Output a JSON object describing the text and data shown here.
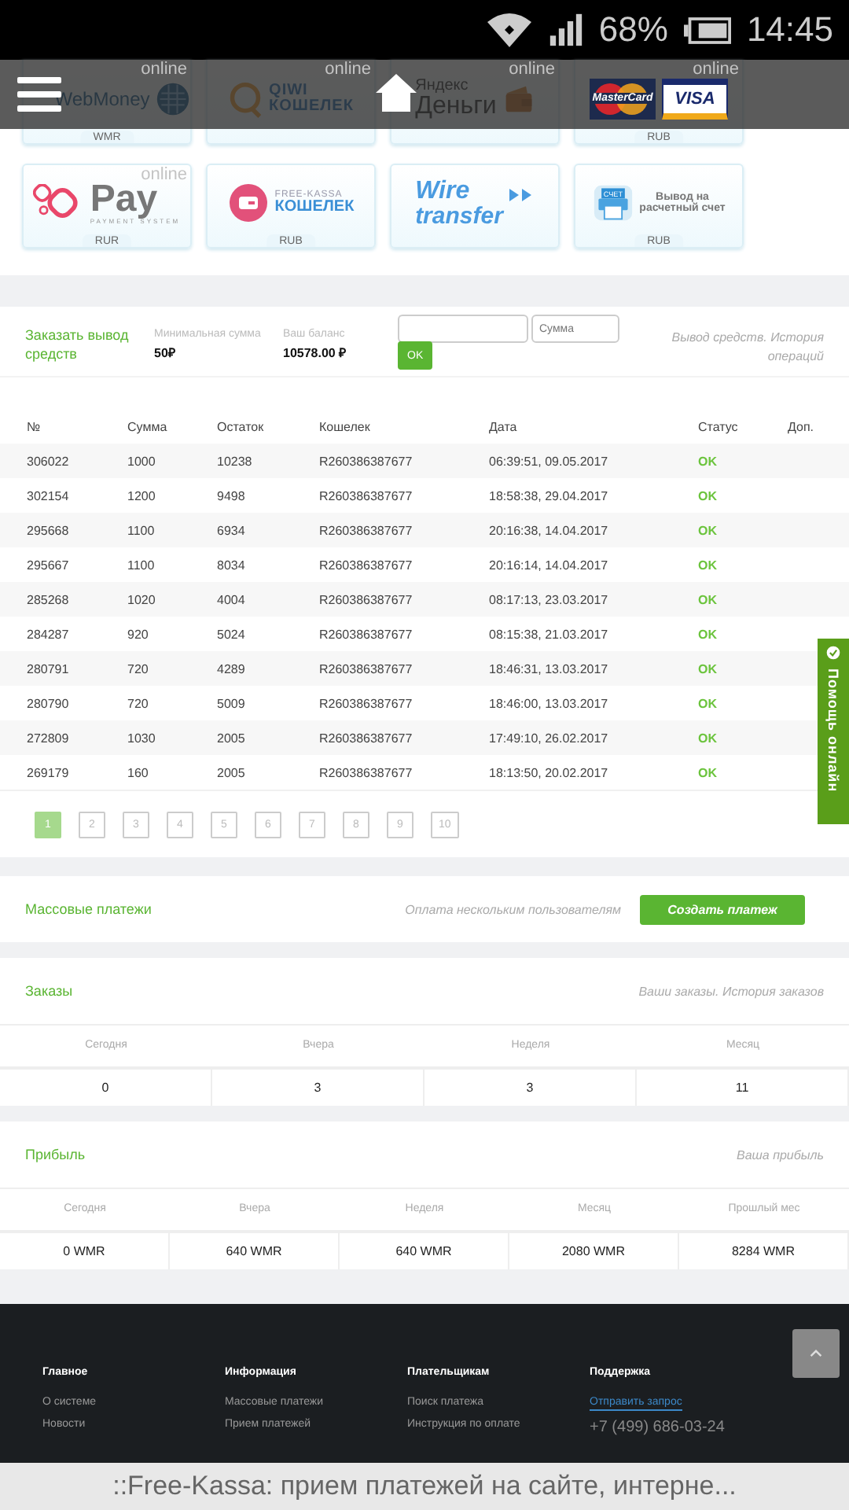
{
  "status_bar": {
    "battery": "68%",
    "time": "14:45"
  },
  "tiles": [
    {
      "kind": "webmoney",
      "badge": "online",
      "logo_lines": [
        "WebMoney"
      ],
      "currency": "WMR"
    },
    {
      "kind": "qiwi",
      "badge": "online",
      "logo_lines": [
        "QIWI",
        "КОШЕЛЕК"
      ]
    },
    {
      "kind": "yandex",
      "badge": "online",
      "logo_lines": [
        "Яндекс",
        "Деньги"
      ]
    },
    {
      "kind": "cards",
      "badge": "online",
      "logo_lines": [
        "MasterCard",
        "VISA"
      ],
      "currency": "RUB"
    },
    {
      "kind": "opay",
      "badge": "online",
      "logo_lines": [
        "Pay",
        "PAYMENT SYSTEM"
      ],
      "currency": "RUR"
    },
    {
      "kind": "freekassa",
      "logo_lines": [
        "FREE-KASSA",
        "КОШЕЛЕК"
      ],
      "currency": "RUB"
    },
    {
      "kind": "wire",
      "logo_lines": [
        "Wire",
        "transfer"
      ]
    },
    {
      "kind": "invoice",
      "icon_label": "СЧЕТ",
      "logo_lines": [
        "Вывод на",
        "расчетный счет"
      ],
      "currency": "RUB"
    }
  ],
  "withdraw": {
    "title": "Заказать вывод средств",
    "min_label": "Минимальная сумма",
    "min_value": "50₽",
    "balance_label": "Ваш баланс",
    "balance_value": "10578.00 ₽",
    "amount_placeholder": "Сумма",
    "ok_button": "OK",
    "note": "Вывод средств. История операций"
  },
  "table": {
    "columns": [
      "№",
      "Сумма",
      "Остаток",
      "Кошелек",
      "Дата",
      "Статус",
      "Доп."
    ],
    "rows": [
      [
        "306022",
        "1000",
        "10238",
        "R260386387677",
        "06:39:51, 09.05.2017",
        "OK"
      ],
      [
        "302154",
        "1200",
        "9498",
        "R260386387677",
        "18:58:38, 29.04.2017",
        "OK"
      ],
      [
        "295668",
        "1100",
        "6934",
        "R260386387677",
        "20:16:38, 14.04.2017",
        "OK"
      ],
      [
        "295667",
        "1100",
        "8034",
        "R260386387677",
        "20:16:14, 14.04.2017",
        "OK"
      ],
      [
        "285268",
        "1020",
        "4004",
        "R260386387677",
        "08:17:13, 23.03.2017",
        "OK"
      ],
      [
        "284287",
        "920",
        "5024",
        "R260386387677",
        "08:15:38, 21.03.2017",
        "OK"
      ],
      [
        "280791",
        "720",
        "4289",
        "R260386387677",
        "18:46:31, 13.03.2017",
        "OK"
      ],
      [
        "280790",
        "720",
        "5009",
        "R260386387677",
        "18:46:00, 13.03.2017",
        "OK"
      ],
      [
        "272809",
        "1030",
        "2005",
        "R260386387677",
        "17:49:10, 26.02.2017",
        "OK"
      ],
      [
        "269179",
        "160",
        "2005",
        "R260386387677",
        "18:13:50, 20.02.2017",
        "OK"
      ]
    ]
  },
  "pagination": [
    {
      "label": "1",
      "selected": true
    },
    {
      "label": "2",
      "selected": false
    },
    {
      "label": "3",
      "selected": false
    },
    {
      "label": "4",
      "selected": false
    },
    {
      "label": "5",
      "selected": false
    },
    {
      "label": "6",
      "selected": false
    },
    {
      "label": "7",
      "selected": false
    },
    {
      "label": "8",
      "selected": false
    },
    {
      "label": "9",
      "selected": false
    },
    {
      "label": "10",
      "selected": false
    }
  ],
  "mass_payments": {
    "title": "Массовые платежи",
    "note": "Оплата нескольким пользователям",
    "button": "Создать платеж"
  },
  "orders": {
    "title": "Заказы",
    "note": "Ваши заказы. История заказов",
    "labels": [
      "Сегодня",
      "Вчера",
      "Неделя",
      "Месяц"
    ],
    "values": [
      "0",
      "3",
      "3",
      "11"
    ]
  },
  "profit": {
    "title": "Прибыль",
    "note": "Ваша прибыль",
    "labels": [
      "Сегодня",
      "Вчера",
      "Неделя",
      "Месяц",
      "Прошлый мес"
    ],
    "values": [
      "0 WMR",
      "640 WMR",
      "640 WMR",
      "2080 WMR",
      "8284 WMR"
    ]
  },
  "footer": [
    {
      "heading": "Главное",
      "links": [
        "О системе",
        "Новости"
      ]
    },
    {
      "heading": "Информация",
      "links": [
        "Массовые платежи",
        "Прием платежей"
      ]
    },
    {
      "heading": "Плательщикам",
      "links": [
        "Поиск платежа",
        "Инструкция по оплате"
      ]
    },
    {
      "heading": "Поддержка",
      "request_link": "Отправить запрос",
      "links": [
        "+7 (499) 686-03-24"
      ]
    }
  ],
  "help_tab": "Помощь онлайн",
  "page_title": "::Free-Kassa: прием платежей на сайте, интерне..."
}
